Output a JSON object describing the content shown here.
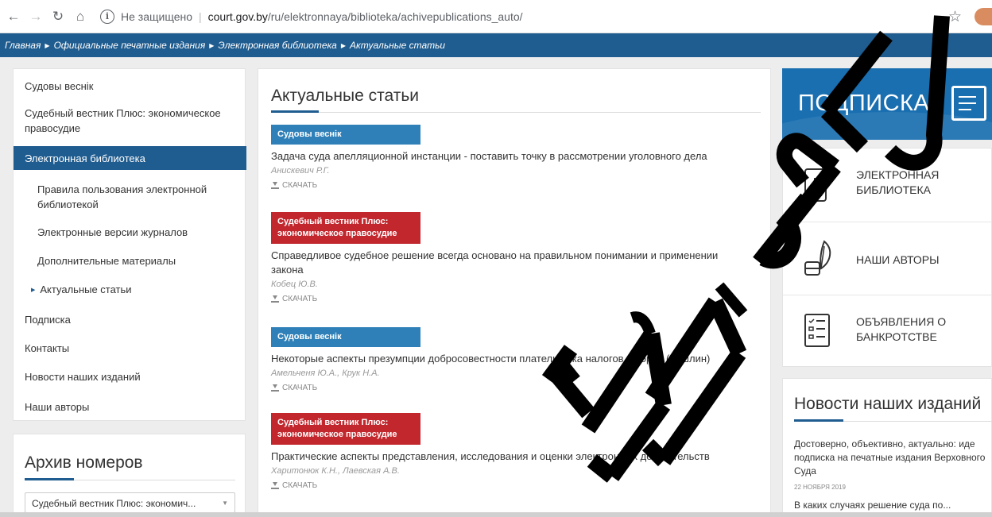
{
  "browser": {
    "security_label": "Не защищено",
    "url_host": "court.gov.by",
    "url_path": "/ru/elektronnaya/biblioteka/achivepublications_auto/",
    "info_glyph": "i"
  },
  "breadcrumb": [
    "Главная",
    "Официальные печатные издания",
    "Электронная библиотека",
    "Актуальные статьи"
  ],
  "sidebar": {
    "items": [
      {
        "label": "Судовы веснік"
      },
      {
        "label": "Судебный вестник Плюс: экономическое правосудие"
      },
      {
        "label": "Электронная библиотека",
        "state": "active"
      },
      {
        "label": "Правила пользования электронной библиотекой",
        "sub": true
      },
      {
        "label": "Электронные версии журналов",
        "sub": true
      },
      {
        "label": "Дополнительные материалы",
        "sub": true
      },
      {
        "label": "Актуальные статьи",
        "sub": true,
        "state": "current"
      },
      {
        "label": "Подписка"
      },
      {
        "label": "Контакты"
      },
      {
        "label": "Новости наших изданий"
      },
      {
        "label": "Наши авторы"
      }
    ]
  },
  "archive": {
    "title": "Архив номеров",
    "select_value": "Судебный вестник Плюс: экономич..."
  },
  "main": {
    "title": "Актуальные статьи",
    "download_label": "СКАЧАТЬ",
    "articles": [
      {
        "badge": "Судовы веснік",
        "badge_color": "#2f80b8",
        "title": "Задача суда апелляционной инстанции - поставить точку в рассмотрении уголовного дела",
        "author": "Анискевич Р.Г."
      },
      {
        "badge": "Судебный вестник Плюс: экономическое правосудие",
        "badge_color": "#c1272d",
        "title": "Справедливое судебное решение всегда основано на правильном понимании и применении закона",
        "author": "Кобец Ю.В."
      },
      {
        "badge": "Судовы веснік",
        "badge_color": "#2f80b8",
        "title": "Некоторые аспекты презумпции добросовестности плательщика налогов, сборов (пошлин)",
        "author": "Амельченя Ю.А., Крук Н.А."
      },
      {
        "badge": "Судебный вестник Плюс: экономическое правосудие",
        "badge_color": "#c1272d",
        "title": "Практические аспекты представления, исследования и оценки электронных доказательств",
        "author": "Харитонюк К.Н., Лаевская А.В."
      }
    ]
  },
  "right": {
    "subscription_label": "ПОДПИСКА",
    "quick_links": [
      {
        "label": "ЭЛЕКТРОННАЯ БИБЛИОТЕКА",
        "icon": "ebook-icon",
        "icon_letter": "E"
      },
      {
        "label": "НАШИ АВТОРЫ",
        "icon": "quill-inkwell-icon"
      },
      {
        "label": "ОБЪЯВЛЕНИЯ О БАНКРОТСТВЕ",
        "icon": "checklist-icon"
      }
    ],
    "news": {
      "title": "Новости наших изданий",
      "item": "Достоверно, объективно, актуально: иде подписка на печатные издания Верховного Суда",
      "date": "22 НОЯБРЯ 2019",
      "item2": "В каких случаях решение суда по..."
    }
  },
  "watermark": {
    "text": "КОПИЙ ВГЈ",
    "color": "#000000"
  }
}
